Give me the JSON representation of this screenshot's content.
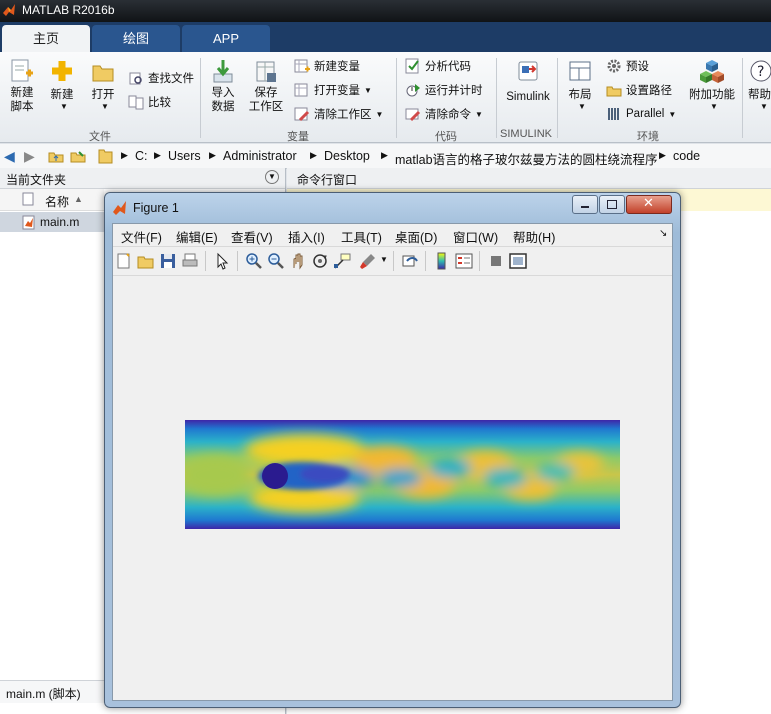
{
  "app": {
    "title": "MATLAB R2016b"
  },
  "tabs": [
    {
      "label": "主页",
      "active": true
    },
    {
      "label": "绘图",
      "active": false
    },
    {
      "label": "APP",
      "active": false
    }
  ],
  "ribbon": {
    "new_script": "新建\n脚本",
    "new": "新建",
    "open": "打开",
    "find_files": "查找文件",
    "compare": "比较",
    "import_data": "导入\n数据",
    "save_workspace": "保存\n工作区",
    "new_variable": "新建变量",
    "open_variable": "打开变量",
    "clear_workspace": "清除工作区",
    "analyze_code": "分析代码",
    "run_and_time": "运行并计时",
    "clear_commands": "清除命令",
    "simulink": "Simulink",
    "layout": "布局",
    "preferences": "预设",
    "set_path": "设置路径",
    "parallel": "Parallel",
    "addons": "附加功能",
    "help": "帮助",
    "groups": {
      "file": "文件",
      "variable": "变量",
      "code": "代码",
      "simulink": "SIMULINK",
      "environment": "环境"
    }
  },
  "address": {
    "crumbs": [
      "C:",
      "Users",
      "Administrator",
      "Desktop",
      "matlab语言的格子玻尔兹曼方法的圆柱绕流程序",
      "code"
    ]
  },
  "left_panel": {
    "title": "当前文件夹",
    "column_name": "名称",
    "sort": "▲",
    "files": [
      {
        "name": "main.m"
      }
    ],
    "details": "main.m  (脚本)"
  },
  "right_panel": {
    "title": "命令行窗口"
  },
  "figure": {
    "title": "Figure 1",
    "menu": [
      "文件(F)",
      "编辑(E)",
      "查看(V)",
      "插入(I)",
      "工具(T)",
      "桌面(D)",
      "窗口(W)",
      "帮助(H)"
    ],
    "tools": [
      "new-figure-icon",
      "open-file-icon",
      "save-icon",
      "print-icon",
      "select-arrow-icon",
      "zoom-in-icon",
      "zoom-out-icon",
      "pan-icon",
      "rotate-icon",
      "data-cursor-icon",
      "brush-icon",
      "link-plot-icon",
      "colorbar-icon",
      "legend-icon",
      "hide-plot-tools-icon",
      "show-plot-tools-icon"
    ]
  },
  "colors": {
    "title_bg": "#101316",
    "tab_bg": "#1d3c66",
    "accent": "#2a568f"
  }
}
